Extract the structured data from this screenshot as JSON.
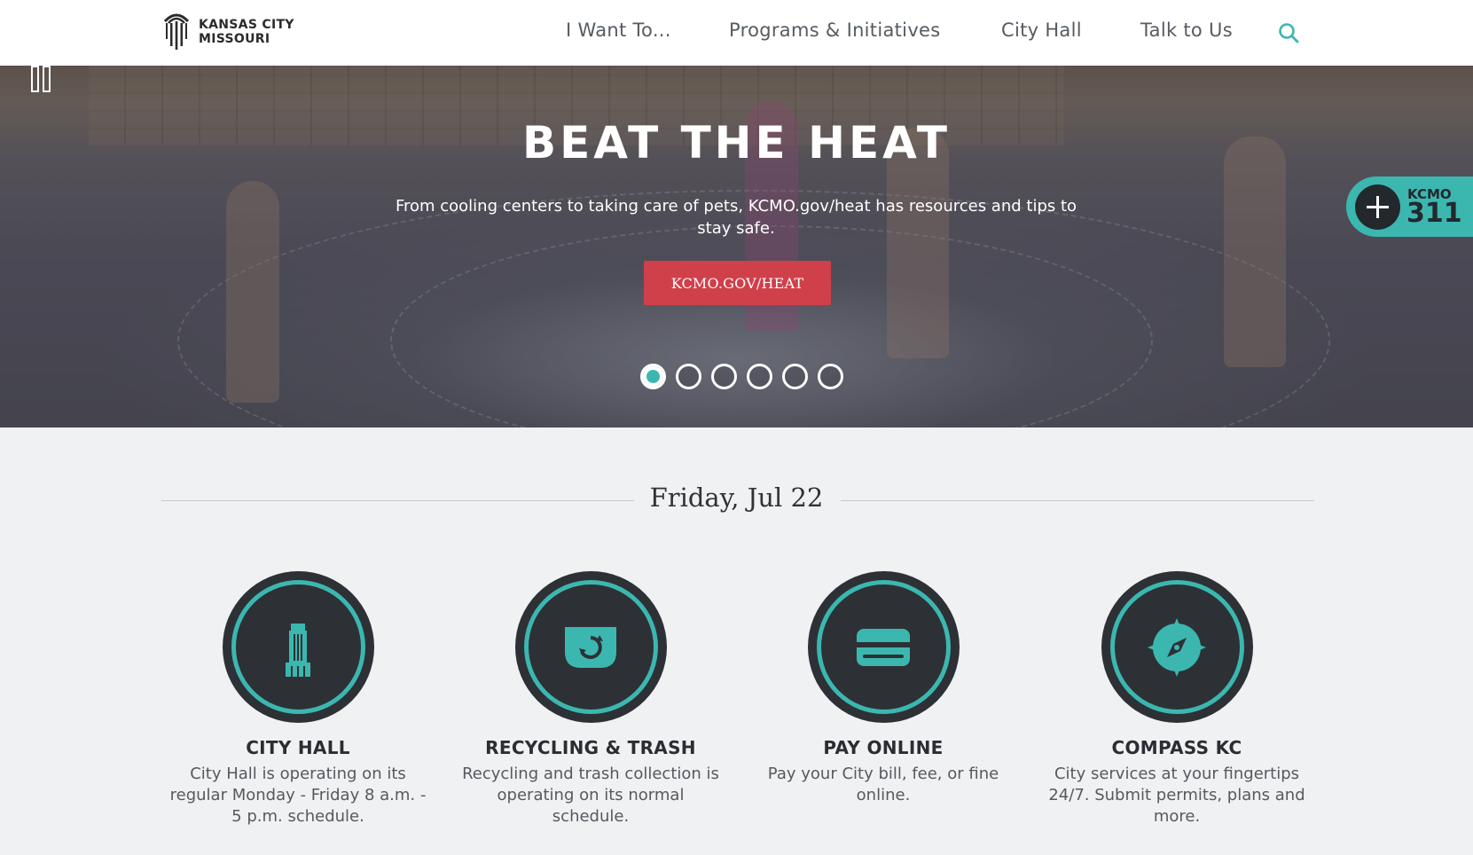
{
  "brand": {
    "logo_line1": "KANSAS CITY",
    "logo_line2": "MISSOURI",
    "accent_color": "#3bb7b0",
    "button_color": "#d0404a",
    "dark_color": "#2d3135"
  },
  "nav": {
    "items": [
      {
        "label": "I Want To..."
      },
      {
        "label": "Programs & Initiatives"
      },
      {
        "label": "City Hall"
      },
      {
        "label": "Talk to Us"
      }
    ],
    "search_icon": "search-icon"
  },
  "hero": {
    "title": "BEAT THE HEAT",
    "subtitle": "From cooling centers to taking care of pets, KCMO.gov/heat has resources and tips to stay safe.",
    "button_label": "KCMO.GOV/HEAT",
    "pause_icon": "pause-icon",
    "slide_count": 6,
    "active_slide": 1
  },
  "badge311": {
    "top": "KCMO",
    "number": "311",
    "icon": "plus-icon"
  },
  "date": "Friday, Jul 22",
  "features": [
    {
      "title": "CITY HALL",
      "description": "City Hall is operating on its regular Monday - Friday 8 a.m. - 5 p.m. schedule.",
      "icon": "city-hall-building-icon"
    },
    {
      "title": "RECYCLING & TRASH",
      "description": "Recycling and trash collection is operating on its normal schedule.",
      "icon": "recycling-bin-icon"
    },
    {
      "title": "PAY ONLINE",
      "description": "Pay your City bill, fee, or fine online.",
      "icon": "credit-card-icon"
    },
    {
      "title": "COMPASS KC",
      "description": "City services at your fingertips 24/7. Submit permits, plans and more.",
      "icon": "compass-icon"
    }
  ]
}
